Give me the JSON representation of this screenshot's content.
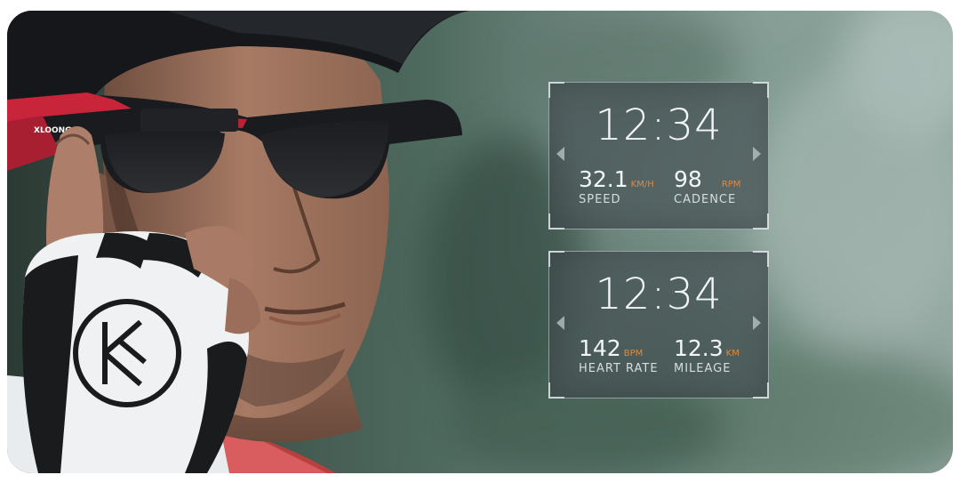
{
  "panels": [
    {
      "time": "12:34",
      "metrics": [
        {
          "value": "32.1",
          "unit": "KM/H",
          "label": "SPEED"
        },
        {
          "value": "98",
          "unit": "RPM",
          "label": "CADENCE"
        }
      ]
    },
    {
      "time": "12:34",
      "metrics": [
        {
          "value": "142",
          "unit": "BPM",
          "label": "HEART RATE"
        },
        {
          "value": "12.3",
          "unit": "KM",
          "label": "MILEAGE"
        }
      ]
    }
  ],
  "photo": {
    "glasses_brand": "XLOONG",
    "accent_color": "#e08a3a",
    "frame_red": "#c8243a"
  }
}
